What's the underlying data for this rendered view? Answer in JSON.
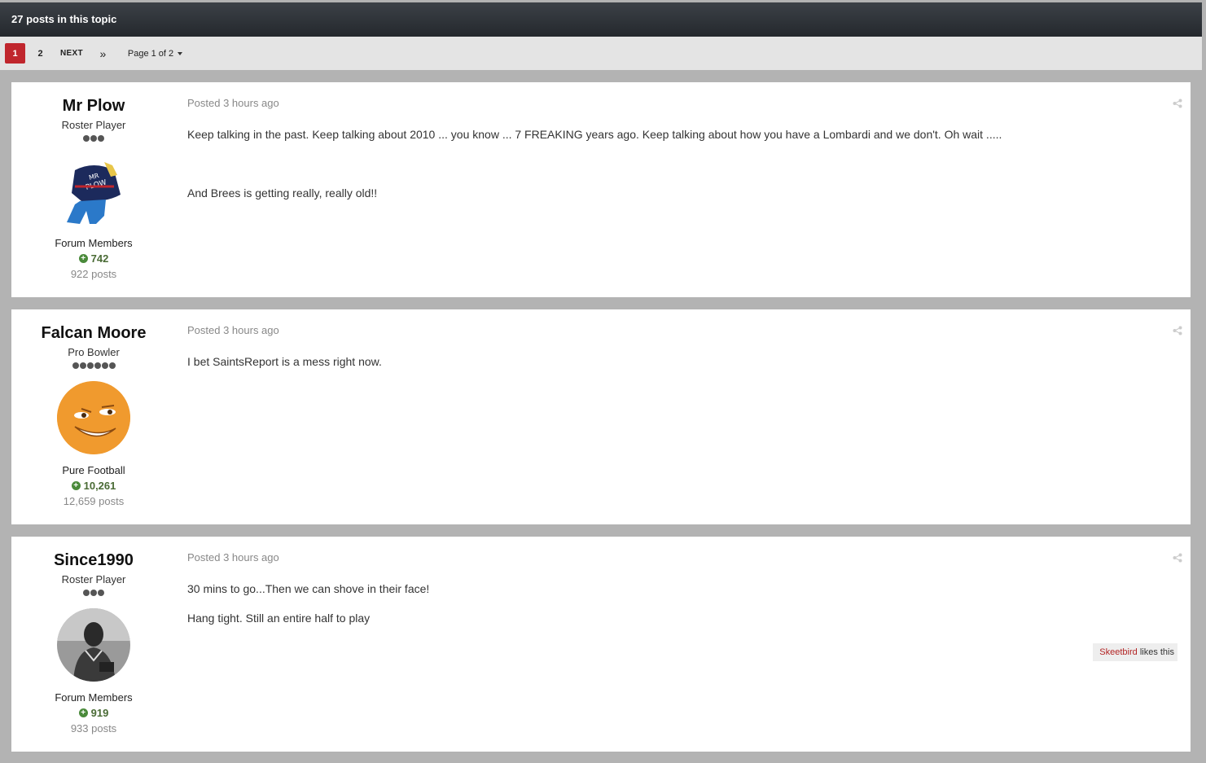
{
  "topic": {
    "posts_count_label": "27 posts in this topic"
  },
  "pagination": {
    "pages": [
      "1",
      "2"
    ],
    "current": "1",
    "next_label": "NEXT",
    "last_icon": "double-chevron-right-icon",
    "page_jump_label": "Page 1 of 2"
  },
  "posts": [
    {
      "author": "Mr Plow",
      "rank": "Roster Player",
      "group": "Forum Members",
      "reputation": "742",
      "post_count": "922 posts",
      "posted": "Posted 3 hours ago",
      "paragraphs": [
        "Keep talking in the past.  Keep talking about 2010 ... you know ... 7 FREAKING years ago.  Keep talking about how you have a Lombardi and we don't.  Oh wait .....",
        "And Brees is getting really, really old!!"
      ]
    },
    {
      "author": "Falcan Moore",
      "rank": "Pro Bowler",
      "group": "Pure Football",
      "reputation": "10,261",
      "post_count": "12,659 posts",
      "posted": "Posted 3 hours ago",
      "paragraphs": [
        "I bet SaintsReport is a mess right now."
      ]
    },
    {
      "author": "Since1990",
      "rank": "Roster Player",
      "group": "Forum Members",
      "reputation": "919",
      "post_count": "933 posts",
      "posted": "Posted 3 hours ago",
      "paragraphs": [
        "30 mins to go...Then we can shove in their face!",
        "Hang tight. Still an entire half to play"
      ],
      "likes": {
        "user": "Skeetbird",
        "suffix": "likes this"
      }
    }
  ],
  "colors": {
    "accent": "#c0262d",
    "reputation": "#4a8a3a",
    "like_user": "#b22323"
  }
}
